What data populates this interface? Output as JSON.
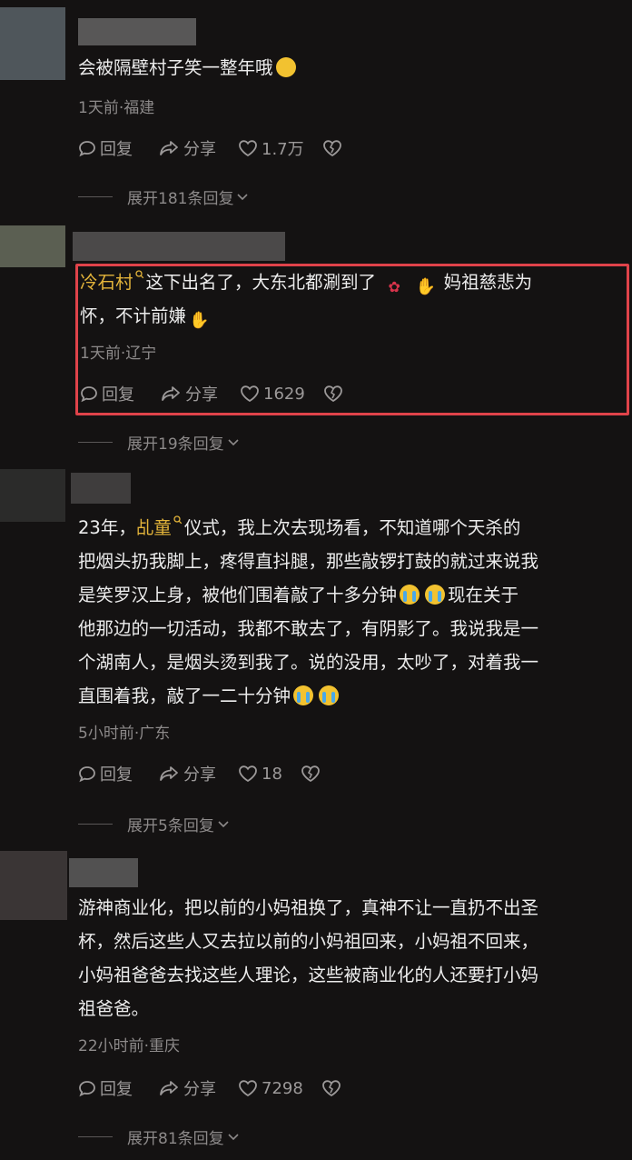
{
  "comments": [
    {
      "text_lines": [
        "会被隔壁村子笑一整年哦"
      ],
      "emoji_after": "smirk-emoji",
      "meta": "1天前·福建",
      "actions": {
        "reply": "回复",
        "share": "分享",
        "likes": "1.7万"
      },
      "expand": "展开181条回复"
    },
    {
      "mention": "冷石村",
      "text_line1": "这下出名了，大东北都涮到了",
      "text_line1b": "妈祖慈悲为",
      "text_line2": "怀，不计前嫌",
      "meta": "1天前·辽宁",
      "actions": {
        "reply": "回复",
        "share": "分享",
        "likes": "1629"
      },
      "expand": "展开19条回复"
    },
    {
      "prefix": "23年，",
      "mention": "乩童",
      "line1_rest": "仪式，我上次去现场看，不知道哪个天杀的",
      "line2": "把烟头扔我脚上，疼得直抖腿，那些敲锣打鼓的就过来说我",
      "line3": "是笑罗汉上身，被他们围着敲了十多分钟",
      "line4a": "现在关于",
      "line4b": "他那边的一切活动，我都不敢去了，有阴影了。我说我是一",
      "line5": "个湖南人，是烟头烫到我了。说的没用，太吵了，对着我一",
      "line6": "直围着我，敲了一二十分钟",
      "meta": "5小时前·广东",
      "actions": {
        "reply": "回复",
        "share": "分享",
        "likes": "18"
      },
      "expand": "展开5条回复"
    },
    {
      "text_lines": [
        "游神商业化，把以前的小妈祖换了，真神不让一直扔不出圣",
        "杯，然后这些人又去拉以前的小妈祖回来，小妈祖不回来，",
        "小妈祖爸爸去找这些人理论，这些被商业化的人还要打小妈",
        "祖爸爸。"
      ],
      "meta": "22小时前·重庆",
      "actions": {
        "reply": "回复",
        "share": "分享",
        "likes": "7298"
      },
      "expand": "展开81条回复"
    }
  ],
  "colors": {
    "background": "#141212",
    "mention": "#e3b43a",
    "highlight_border": "#e0434a",
    "muted": "#8d8a8a"
  }
}
